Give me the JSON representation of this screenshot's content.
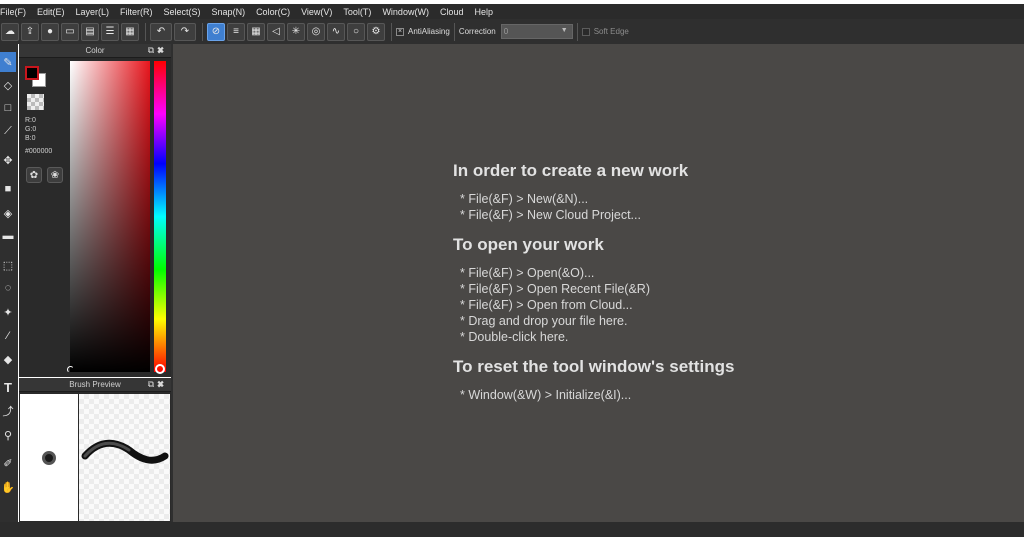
{
  "menu": [
    "File(F)",
    "Edit(E)",
    "Layer(L)",
    "Filter(R)",
    "Select(S)",
    "Snap(N)",
    "Color(C)",
    "View(V)",
    "Tool(T)",
    "Window(W)",
    "Cloud",
    "Help"
  ],
  "toolbar": {
    "antialiasing_label": "AntiAliasing",
    "correction_label": "Correction",
    "correction_value": "0",
    "soft_edge_label": "Soft Edge"
  },
  "color_panel": {
    "title": "Color",
    "r": "R:0",
    "g": "G:0",
    "b": "B:0",
    "hex": "#000000",
    "fg_color": "#000000",
    "bg_color": "#ffffff",
    "hue_color": "#e8161d"
  },
  "brush_panel": {
    "title": "Brush Preview"
  },
  "help": {
    "section1_title": "In order to create a new work",
    "section1_items": [
      "* File(&F) > New(&N)...",
      "* File(&F) > New Cloud Project..."
    ],
    "section2_title": "To open your work",
    "section2_items": [
      "* File(&F) > Open(&O)...",
      "* File(&F) > Open Recent File(&R)",
      "* File(&F) > Open from Cloud...",
      "* Drag and drop your file here.",
      "* Double-click here."
    ],
    "section3_title": "To reset the tool window's settings",
    "section3_items": [
      "* Window(&W) > Initialize(&I)..."
    ]
  }
}
